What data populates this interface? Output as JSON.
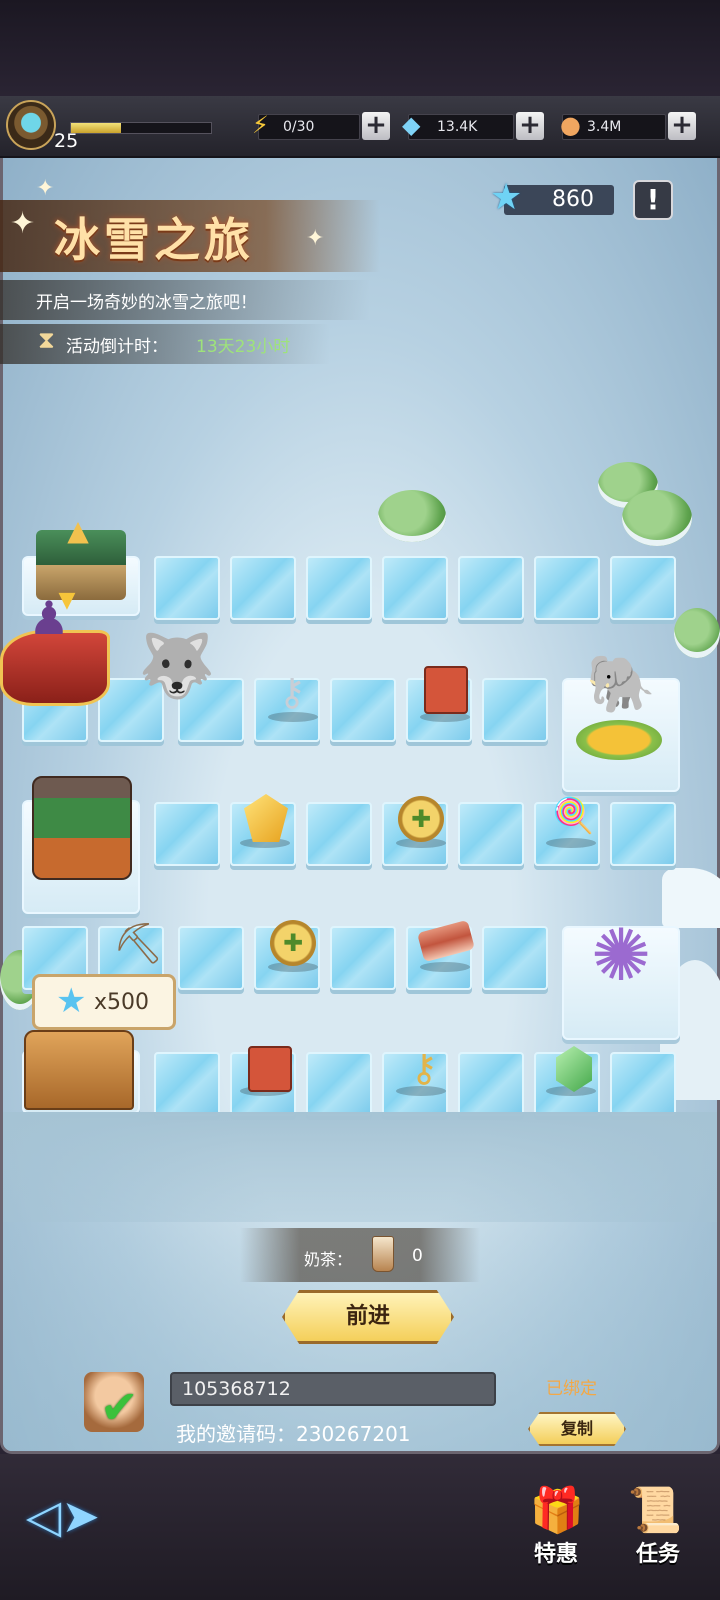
{
  "topbar": {
    "level": "25",
    "xp_fraction": 0.36,
    "energy": "0/30",
    "gems": "13.4K",
    "coins": "3.4M",
    "plus": "+"
  },
  "event": {
    "title": "冰雪之旅",
    "subtitle": "开启一场奇妙的冰雪之旅吧！",
    "countdown_label": "活动倒计时：",
    "countdown_value": "13天23小时",
    "stars": "860",
    "info": "!"
  },
  "board": {
    "reward_callout": "x500"
  },
  "advance": {
    "milktea_label": "奶茶：",
    "milktea_count": "0",
    "button_label": "前进"
  },
  "invite": {
    "input_value": "105368712",
    "my_code": "我的邀请码：230267201",
    "bound_label": "已绑定",
    "copy_label": "复制"
  },
  "nav": {
    "deals_label": "特惠",
    "tasks_label": "任务"
  },
  "icons": {
    "energy": "lightning-icon",
    "gems": "crystal-icon",
    "coins": "coin-icon",
    "star": "star-icon"
  },
  "colors": {
    "title": "#ffe1a8",
    "countdown": "#9ee37a",
    "bound": "#f4a845",
    "star": "#6fd3f5"
  }
}
